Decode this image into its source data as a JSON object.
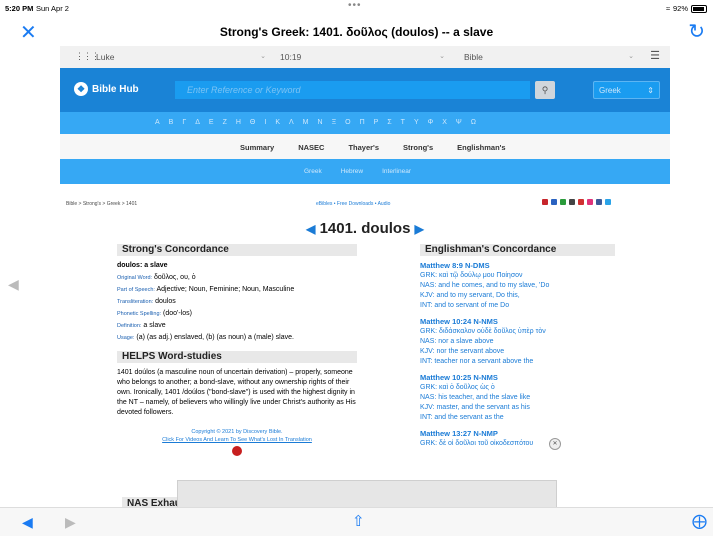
{
  "status": {
    "time": "5:20 PM",
    "date": "Sun Apr 2",
    "battery": "92%",
    "dots": "•••"
  },
  "window": {
    "title": "Strong's Greek: 1401. δοῦλος (doulos) -- a slave"
  },
  "selectors": {
    "book": "Luke",
    "chapter": "10:19",
    "version": "Bible"
  },
  "header": {
    "logo": "Bible Hub",
    "search_placeholder": "Enter Reference or Keyword",
    "language": "Greek"
  },
  "alphabet": [
    "Α",
    "Β",
    "Γ",
    "Δ",
    "Ε",
    "Ζ",
    "Η",
    "Θ",
    "Ι",
    "Κ",
    "Λ",
    "Μ",
    "Ν",
    "Ξ",
    "Ο",
    "Π",
    "Ρ",
    "Σ",
    "Τ",
    "Υ",
    "Φ",
    "Χ",
    "Ψ",
    "Ω"
  ],
  "tabs": [
    "Summary",
    "NASEC",
    "Thayer's",
    "Strong's",
    "Englishman's"
  ],
  "subtabs": [
    "Greek",
    "Hebrew",
    "Interlinear"
  ],
  "breadcrumb": "Bible > Strong's > Greek > 1401",
  "downloads": "eBibles • Free Downloads • Audio",
  "heading": "1401. doulos",
  "strongs": {
    "title": "Strong's Concordance",
    "word": "doulos: a slave",
    "original_label": "Original Word:",
    "original": "δοῦλος, ου, ὁ",
    "pos_label": "Part of Speech:",
    "pos": "Adjective; Noun, Feminine; Noun, Masculine",
    "translit_label": "Transliteration:",
    "translit": "doulos",
    "phonetic_label": "Phonetic Spelling:",
    "phonetic": "(doo'-los)",
    "definition_label": "Definition:",
    "definition": "a slave",
    "usage_label": "Usage:",
    "usage": "(a) (as adj.) enslaved, (b) (as noun) a (male) slave."
  },
  "helps": {
    "title": "HELPS Word-studies",
    "text": "1401 doúlos (a masculine noun of uncertain derivation) – properly, someone who belongs to another; a bond-slave, without any ownership rights of their own. Ironically, 1401 /doúlos (\"bond-slave\") is used with the highest dignity in the NT – namely, of believers who willingly live under Christ's authority as His devoted followers.",
    "copyright": "Copyright © 2021 by Discovery Bible.",
    "link": "Click For Videos And Learn To See What's Lost In Translation"
  },
  "englishman": {
    "title": "Englishman's Concordance",
    "entries": [
      {
        "ref": "Matthew 8:9 N-DMS",
        "grk": "GRK: καὶ τῷ δούλῳ μου Ποίησον",
        "nas": "NAS: and he comes, and to my slave, 'Do",
        "kjv": "KJV: and to my servant, Do this,",
        "int": "INT: and to servant of me Do"
      },
      {
        "ref": "Matthew 10:24 N-NMS",
        "grk": "GRK: διδάσκαλον οὐδὲ δοῦλος ὑπὲρ τὸν",
        "nas": "NAS: nor a slave above",
        "kjv": "KJV: nor the servant above",
        "int": "INT: teacher nor a servant above the"
      },
      {
        "ref": "Matthew 10:25 N-NMS",
        "grk": "GRK: καὶ ὁ δοῦλος ὡς ὁ",
        "nas": "NAS: his teacher, and the slave like",
        "kjv": "KJV: master, and the servant as his",
        "int": "INT: and the servant as the"
      },
      {
        "ref": "Matthew 13:27 N-NMP",
        "grk": "GRK: δὲ οἱ δοῦλοι τοῦ οἰκοδεσπότου"
      }
    ]
  },
  "nas_exhaustive": "NAS Exhau"
}
